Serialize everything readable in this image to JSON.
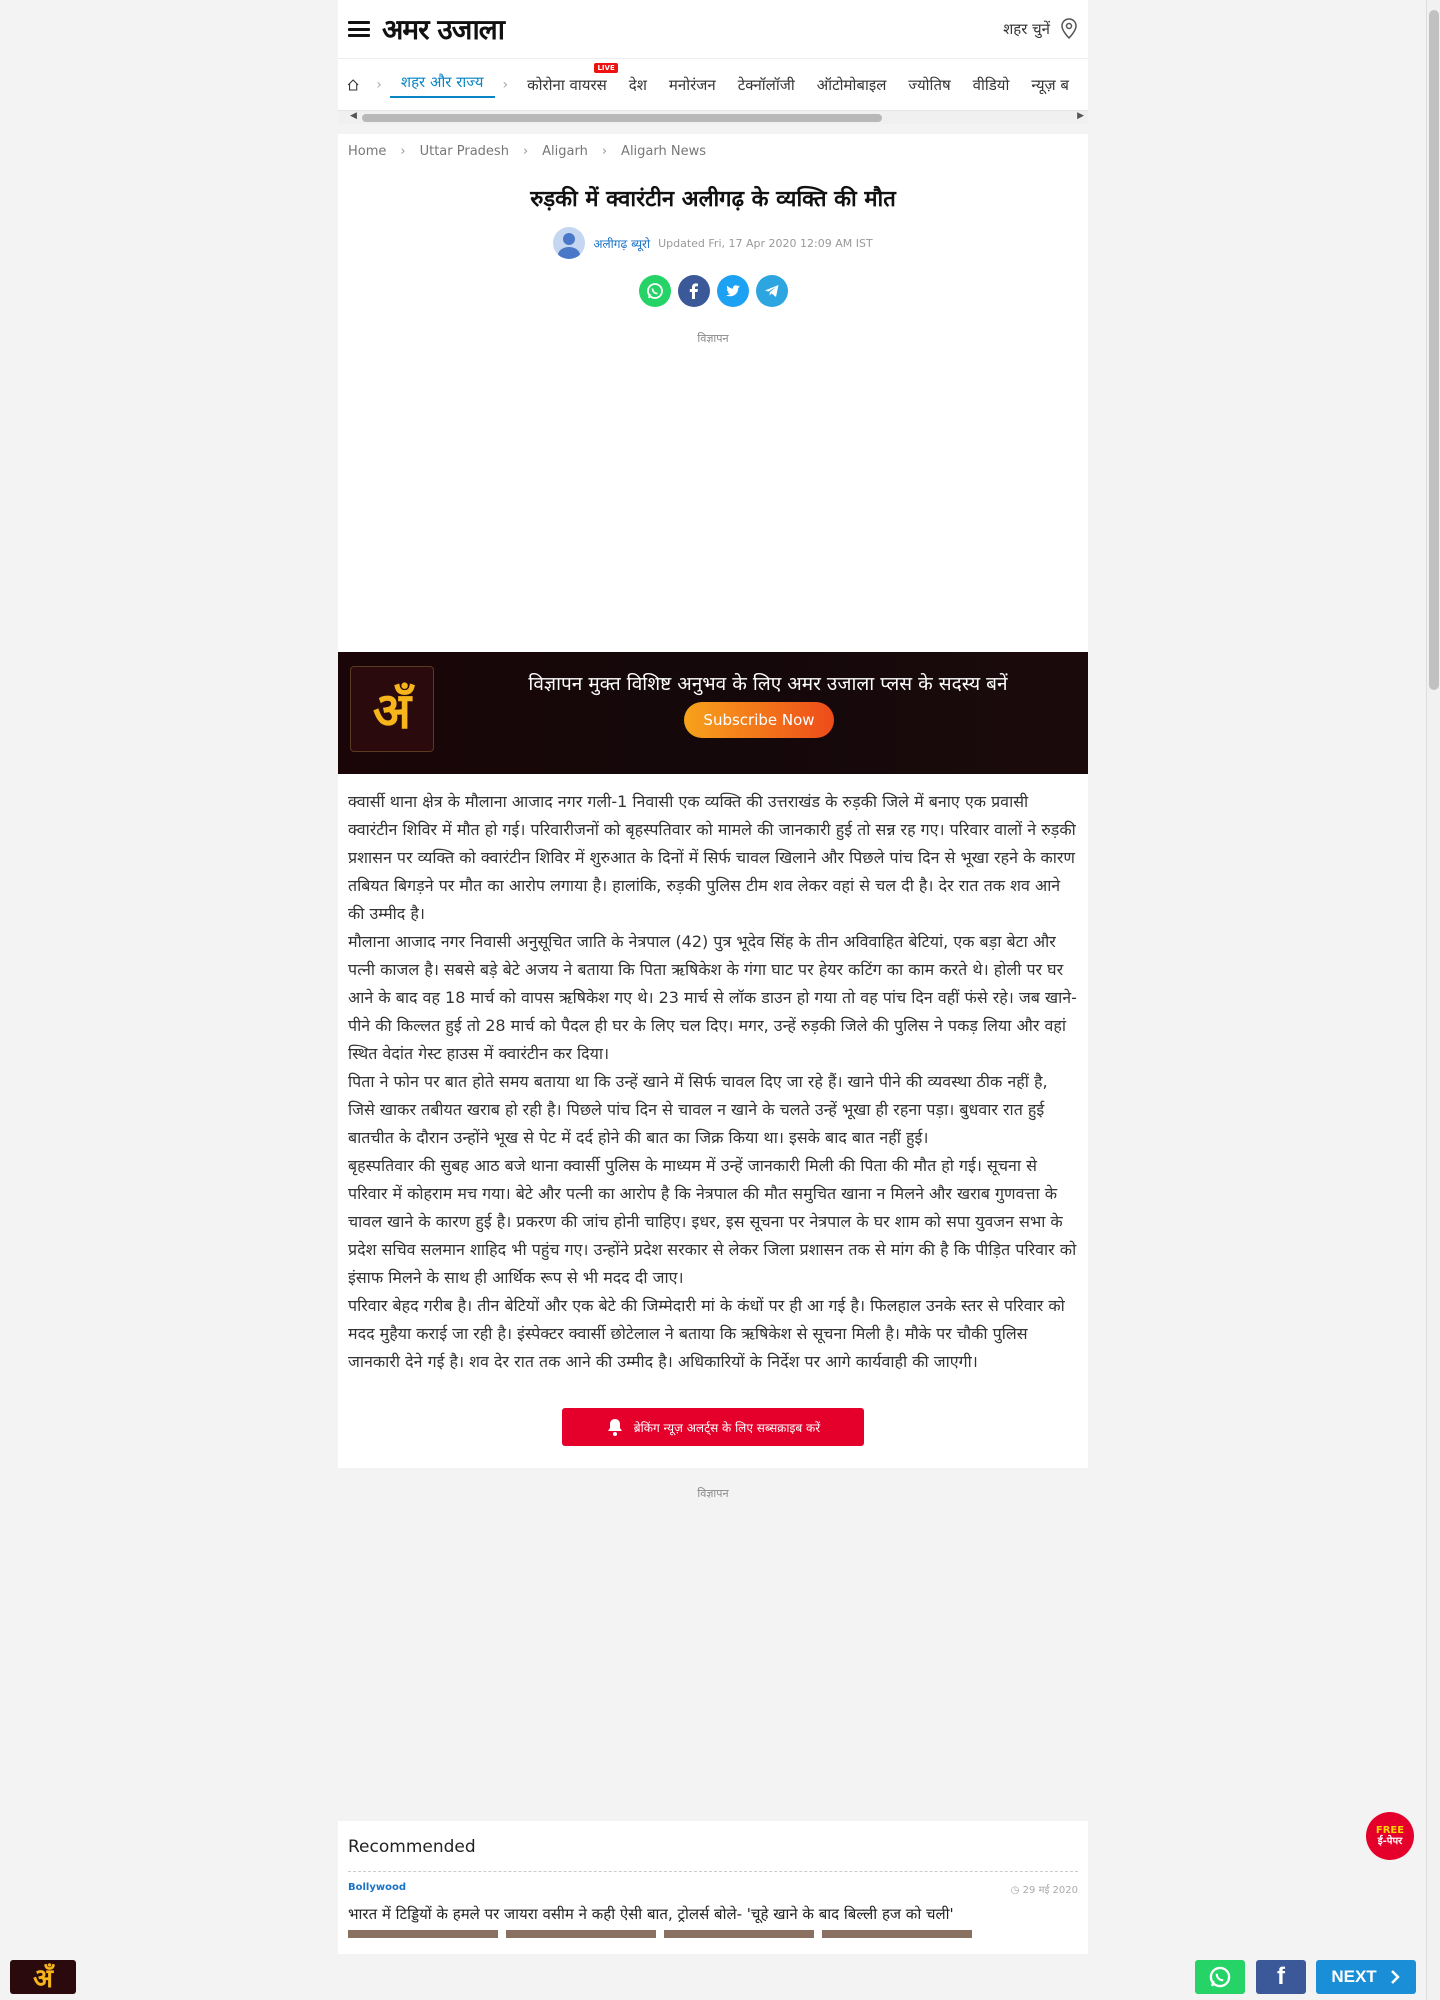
{
  "header": {
    "logo": "अमर उजाला",
    "city_label": "शहर चुनें"
  },
  "nav": {
    "items": [
      {
        "label": "शहर और राज्य",
        "active": true
      },
      {
        "label": "कोरोना वायरस",
        "badge": "LIVE"
      },
      {
        "label": "देश"
      },
      {
        "label": "मनोरंजन"
      },
      {
        "label": "टेक्नॉलॉजी"
      },
      {
        "label": "ऑटोमोबाइल"
      },
      {
        "label": "ज्योतिष"
      },
      {
        "label": "वीडियो"
      },
      {
        "label": "न्यूज़ ब"
      }
    ]
  },
  "breadcrumb": [
    "Home",
    "Uttar Pradesh",
    "Aligarh",
    "Aligarh News"
  ],
  "article": {
    "title": "रुड़की में क्वारंटीन अलीगढ़ के व्यक्ति की मौत",
    "author": "अलीगढ़ ब्यूरो",
    "updated": "Updated Fri, 17 Apr 2020 12:09 AM IST",
    "ad_label": "विज्ञापन",
    "paragraphs": [
      "क्वार्सी थाना क्षेत्र के मौलाना आजाद नगर गली-1 निवासी एक व्यक्ति की उत्तराखंड के रुड़की जिले में बनाए एक प्रवासी क्वारंटीन शिविर में मौत हो गई। परिवारीजनों को बृहस्पतिवार को मामले की जानकारी हुई तो सन्न रह गए। परिवार वालों ने रुड़की प्रशासन पर व्यक्ति को क्वारंटीन शिविर में शुरुआत के दिनों में सिर्फ चावल खिलाने और पिछले पांच दिन से भूखा रहने के कारण तबियत बिगड़ने पर मौत का आरोप लगाया है। हालांकि, रुड़की पुलिस टीम शव लेकर वहां से चल दी है। देर रात तक शव आने की उम्मीद है।",
      "मौलाना आजाद नगर निवासी अनुसूचित जाति के नेत्रपाल (42) पुत्र भूदेव सिंह के तीन अविवाहित बेटियां, एक बड़ा बेटा और पत्नी काजल है। सबसे बड़े बेटे अजय ने बताया कि पिता ऋषिकेश के गंगा घाट पर हेयर कटिंग का काम करते थे। होली पर घर आने के बाद वह 18 मार्च को वापस ऋषिकेश गए थे। 23 मार्च से लॉक डाउन हो गया तो वह पांच दिन वहीं फंसे रहे। जब खाने-पीने की किल्लत हुई तो 28 मार्च को पैदल ही घर के लिए चल दिए। मगर, उन्हें रुड़की जिले की पुलिस ने पकड़ लिया और वहां स्थित वेदांत गेस्ट हाउस में क्वारंटीन कर दिया।",
      "पिता ने फोन पर बात होते समय बताया था कि उन्हें खाने में सिर्फ चावल दिए जा रहे हैं। खाने पीने की व्यवस्था ठीक नहीं है, जिसे खाकर तबीयत खराब हो रही है। पिछले पांच दिन से चावल न खाने के चलते उन्हें भूखा ही रहना पड़ा। बुधवार रात हुई बातचीत के दौरान उन्होंने भूख से पेट में दर्द होने की बात का जिक्र किया था। इसके बाद बात नहीं हुई।",
      "बृहस्पतिवार की सुबह आठ बजे थाना क्वार्सी पुलिस के माध्यम में उन्हें जानकारी मिली की पिता की मौत हो गई। सूचना से परिवार में कोहराम मच गया। बेटे और पत्नी का आरोप है कि नेत्रपाल की मौत समुचित खाना न मिलने और खराब गुणवत्ता के चावल खाने के कारण हुई है। प्रकरण की जांच होनी चाहिए। इधर, इस सूचना पर नेत्रपाल के घर शाम को सपा युवजन सभा के प्रदेश सचिव सलमान शाहिद भी पहुंच गए। उन्होंने प्रदेश सरकार से लेकर जिला प्रशासन तक से मांग की है कि पीड़ित परिवार को इंसाफ मिलने के साथ ही आर्थिक रूप से भी मदद दी जाए।",
      "परिवार बेहद गरीब है। तीन बेटियों और एक बेटे की जिम्मेदारी मां के कंधों पर ही आ गई है। फिलहाल उनके स्तर से परिवार को मदद मुहैया कराई जा रही है। इंस्पेक्टर क्वार्सी छोटेलाल ने बताया कि ऋषिकेश से सूचना मिली है। मौके पर चौकी पुलिस जानकारी देने गई है। शव देर रात तक आने की उम्मीद है। अधिकारियों के निर्देश पर आगे कार्यवाही की जाएगी।"
    ],
    "alert_button": "ब्रेकिंग न्यूज़ अलर्ट्स के लिए सब्सक्राइब करें"
  },
  "plus_banner": {
    "logo_glyph": "अँ",
    "text": "विज्ञापन मुक्त विशिष्ट अनुभव के लिए अमर उजाला प्लस के सदस्य बनें",
    "button": "Subscribe Now"
  },
  "ad2_label": "विज्ञापन",
  "recommended": {
    "heading": "Recommended",
    "items": [
      {
        "category": "Bollywood",
        "date": "29 मई 2020",
        "title": "भारत में टिड्डियों के हमले पर जायरा वसीम ने कही ऐसी बात, ट्रोलर्स बोले- 'चूहे खाने के बाद बिल्ली हज को चली'"
      }
    ]
  },
  "floating": {
    "epaper_top": "FREE",
    "epaper_bottom": "ई-पेपर",
    "next_label": "NEXT",
    "logo_glyph": "अँ"
  },
  "icons": [
    "hamburger-icon",
    "location-pin-icon",
    "home-icon",
    "whatsapp-icon",
    "facebook-icon",
    "twitter-icon",
    "telegram-icon",
    "bell-icon",
    "clock-icon",
    "chevron-right-icon"
  ],
  "colors": {
    "accent": "#0a85c4",
    "alert": "#e4002b",
    "whatsapp": "#25d366",
    "facebook": "#3b5998",
    "twitter": "#1da1f2",
    "telegram": "#2ca5e0",
    "next": "#1a8fd8"
  }
}
